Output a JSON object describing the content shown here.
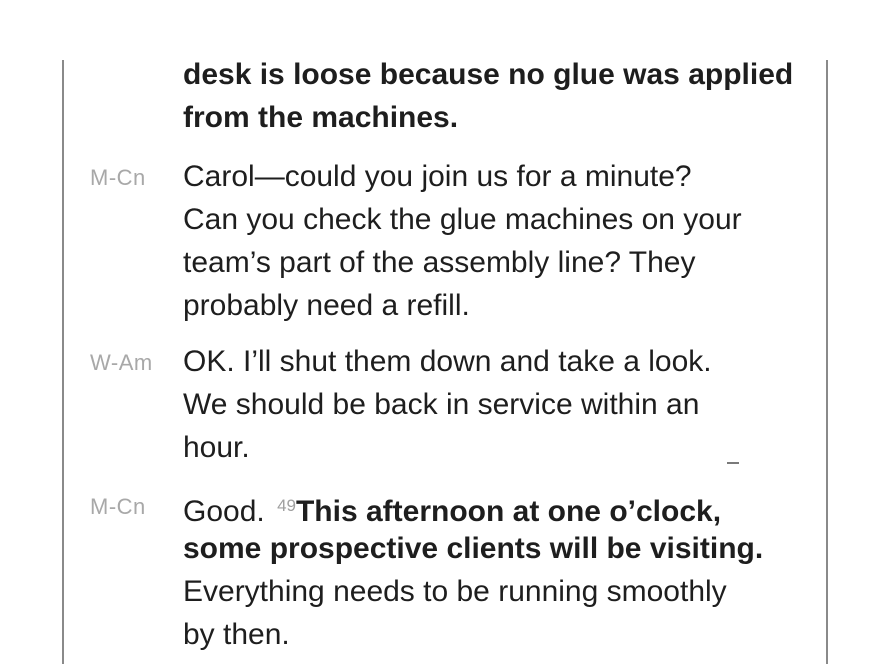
{
  "turns": [
    {
      "speaker": "",
      "lines": [
        [
          {
            "text": "desk is loose because no glue was applied",
            "bold": true
          }
        ],
        [
          {
            "text": "from the machines.",
            "bold": true
          }
        ]
      ]
    },
    {
      "speaker": "M-Cn",
      "lines": [
        [
          {
            "text": "Carol—could you join us for a minute?",
            "bold": false
          }
        ],
        [
          {
            "text": "Can you check the glue machines on your",
            "bold": false
          }
        ],
        [
          {
            "text": "team’s part of the assembly line? They",
            "bold": false
          }
        ],
        [
          {
            "text": "probably need a refill.",
            "bold": false
          }
        ]
      ]
    },
    {
      "speaker": "W-Am",
      "lines": [
        [
          {
            "text": "OK. I’ll shut them down and take a look.",
            "bold": false
          }
        ],
        [
          {
            "text": "We should be back in service within an",
            "bold": false
          }
        ],
        [
          {
            "text": "hour.",
            "bold": false
          }
        ]
      ]
    },
    {
      "speaker": "M-Cn",
      "lines": [
        [
          {
            "text": "Good. ",
            "bold": false
          },
          {
            "text": "49",
            "qnum": true
          },
          {
            "text": "This afternoon at one o’clock,",
            "bold": true
          }
        ],
        [
          {
            "text": "some prospective clients will be visiting.",
            "bold": true
          }
        ],
        [
          {
            "text": "Everything needs to be running smoothly",
            "bold": false
          }
        ],
        [
          {
            "text": "by then.",
            "bold": false
          }
        ]
      ]
    }
  ]
}
